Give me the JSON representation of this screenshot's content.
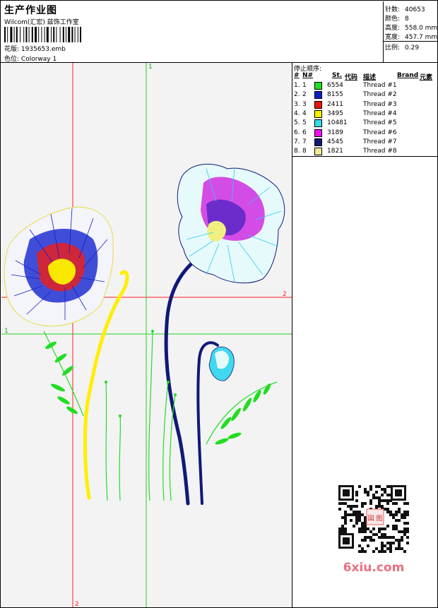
{
  "header": {
    "title": "生产作业图",
    "subtitle": "Wilcom(汇宏) 兹饰工作室",
    "pattern_label": "花版:",
    "pattern_value": "1935653.emb",
    "colorway_label": "色位:",
    "colorway_value": "Colorway 1"
  },
  "stats": {
    "stitches_label": "针数:",
    "stitches_value": "40653",
    "colors_label": "颜色:",
    "colors_value": "8",
    "height_label": "高度:",
    "height_value": "558.0 mm",
    "width_label": "宽度:",
    "width_value": "457.7 mm",
    "ratio_label": "比例:",
    "ratio_value": "0.29"
  },
  "legend": {
    "title": "停止顺序:",
    "headers": {
      "hash": "#",
      "no": "N#",
      "st": "St.",
      "code": "代码",
      "desc": "描述",
      "brand": "Brand",
      "elem": "元素"
    },
    "rows": [
      {
        "idx": "1.",
        "no": "1",
        "color": "#22dd22",
        "code": "6554",
        "desc": "Thread #1"
      },
      {
        "idx": "2.",
        "no": "2",
        "color": "#1020c8",
        "code": "8155",
        "desc": "Thread #2"
      },
      {
        "idx": "3.",
        "no": "3",
        "color": "#ee1111",
        "code": "2411",
        "desc": "Thread #3"
      },
      {
        "idx": "4.",
        "no": "4",
        "color": "#f4f000",
        "code": "3495",
        "desc": "Thread #4"
      },
      {
        "idx": "5.",
        "no": "5",
        "color": "#33dde8",
        "code": "10481",
        "desc": "Thread #5"
      },
      {
        "idx": "6.",
        "no": "6",
        "color": "#ee11ee",
        "code": "3189",
        "desc": "Thread #6"
      },
      {
        "idx": "7.",
        "no": "7",
        "color": "#101870",
        "code": "4545",
        "desc": "Thread #7"
      },
      {
        "idx": "8.",
        "no": "8",
        "color": "#f4e890",
        "code": "1821",
        "desc": "Thread #8"
      }
    ]
  },
  "guides": {
    "red_v": "2",
    "red_h": "2",
    "green_v": "1",
    "green_h": "1"
  },
  "watermark": {
    "site": "6xiu.com",
    "stamp": "図 图"
  }
}
